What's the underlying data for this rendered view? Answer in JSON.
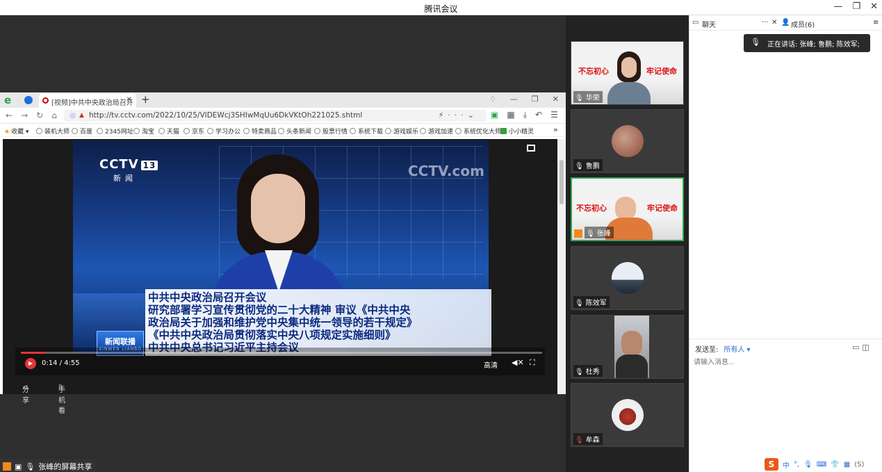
{
  "window": {
    "title": "腾讯会议",
    "controls": [
      "—",
      "❐",
      "✕"
    ]
  },
  "browser": {
    "tab_title": "[视频]中共中央政治局召开",
    "url": "http://tv.cctv.com/2022/10/25/VIDEWcj3SHIwMqUu6DkVKtOh221025.shtml",
    "bookmarks": [
      "收藏",
      "装机大师",
      "百度",
      "2345网址",
      "淘宝",
      "天猫",
      "京东",
      "学习办公",
      "特卖商品",
      "头条新闻",
      "股票行情",
      "系统下载",
      "游戏娱乐",
      "游戏加速",
      "系统优化大师",
      "小小精灵"
    ]
  },
  "video": {
    "channel_logo": "CCTV",
    "channel_num": "13",
    "channel_sub": "新闻",
    "watermark": "CCTV.com",
    "program_cn": "新闻联播",
    "program_en": "XINWEN LIANBO",
    "caption_lines": [
      "中共中央政治局召开会议",
      "研究部署学习宣传贯彻党的二十大精神 审议《中共中央",
      "政治局关于加强和维护党中央集中统一领导的若干规定》",
      "《中共中央政治局贯彻落实中央八项规定实施细则》",
      "中共中央总书记习近平主持会议"
    ],
    "time": "0:14 / 4:55",
    "progress": 0.047,
    "quality": "高清",
    "share_label": "分享",
    "mobile_label": "手机看"
  },
  "screen_share_label": "张峰的屏幕共享",
  "participants": [
    {
      "name": "华荣",
      "type": "video"
    },
    {
      "name": "鲁鹏",
      "type": "avatar"
    },
    {
      "name": "张峰",
      "type": "video",
      "active": true
    },
    {
      "name": "陈效军",
      "type": "avatar"
    },
    {
      "name": "杜秀",
      "type": "video"
    },
    {
      "name": "牟森",
      "type": "avatar"
    }
  ],
  "tile_banner": {
    "left": "不忘初心",
    "right": "牢记使命"
  },
  "chat": {
    "tab_chat": "聊天",
    "tab_more": "···",
    "tab_members": "成员(6)",
    "speaking": "正在讲话: 张峰; 鲁鹏; 陈效军;",
    "send_to_label": "发送至:",
    "send_to_value": "所有人 ▾",
    "input_placeholder": "请输入消息...",
    "ime_lang": "中",
    "ime_suffix": "(S)"
  },
  "colors": {
    "accent": "#2c6fd6",
    "active_border": "#2fa84f",
    "progress": "#e53535"
  }
}
